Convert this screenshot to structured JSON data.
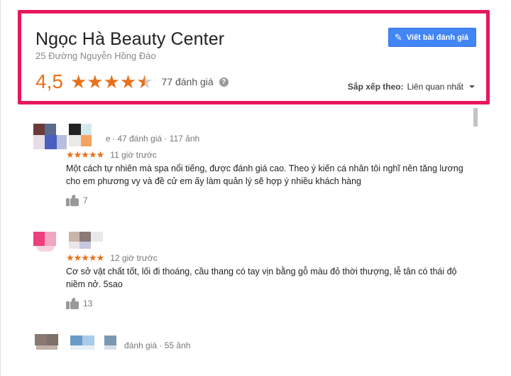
{
  "business": {
    "name": "Ngọc Hà Beauty Center",
    "address": "25 Đường Nguyễn Hồng Đào",
    "rating": "4,5",
    "rating_value": 4.5,
    "review_count_label": "77 đánh giá",
    "help_glyph": "?"
  },
  "actions": {
    "write_review_label": "Viết bài đánh giá",
    "pencil_icon": "pencil-icon"
  },
  "sort": {
    "label": "Sắp xếp theo:",
    "value": "Liên quan nhất"
  },
  "reviews": [
    {
      "name_fragment": "e",
      "meta": "· 47 đánh giá · 117 ảnh",
      "stars": "★★★★★",
      "time": "11 giờ trước",
      "text": "Một cách tự nhiên mà spa nổi tiếng, được đánh giá cao. Theo ý kiến cá nhân tôi nghĩ nên tăng lương cho em phương vy và đề cử em ấy làm quản lý sẽ hợp ý nhiều khách hàng",
      "likes": "7"
    },
    {
      "name_fragment": "",
      "meta": "",
      "stars": "★★★★★",
      "time": "12 giờ trước",
      "text": "Cơ sở vật chất tốt, lối đi thoáng, cầu thang có tay vịn bằng gỗ màu đỏ thời thượng, lễ tân có thái độ niềm nở. 5sao",
      "likes": "13"
    },
    {
      "name_fragment": "",
      "meta": "đánh giá · 55 ảnh",
      "stars": "",
      "time": "",
      "text": "",
      "likes": ""
    }
  ],
  "colors": {
    "highlight_border": "#e8175d",
    "accent_orange": "#e7711b",
    "button_blue": "#4285f4"
  }
}
